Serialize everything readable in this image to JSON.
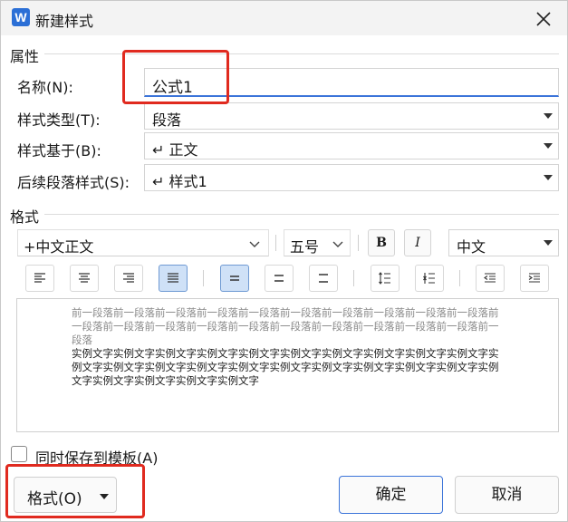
{
  "window": {
    "app_icon": "W",
    "title": "新建样式",
    "close_icon": "close-icon"
  },
  "properties": {
    "group_label": "属性",
    "name_label": "名称(N):",
    "name_value": "公式1",
    "type_label": "样式类型(T):",
    "type_value": "段落",
    "based_label": "样式基于(B):",
    "based_value": "↵ 正文",
    "next_label": "后续段落样式(S):",
    "next_value": "↵ 样式1"
  },
  "format": {
    "group_label": "格式",
    "font": "+中文正文",
    "size": "五号",
    "bold": "B",
    "italic": "I",
    "script": "中文",
    "paragraph_buttons": [
      "align-left-icon",
      "align-center-icon",
      "align-right-icon",
      "align-justify-icon",
      "line-spacing-single-icon",
      "line-spacing-1.5-icon",
      "line-spacing-double-icon",
      "spacing-increase-icon",
      "spacing-decrease-icon",
      "indent-decrease-icon",
      "indent-increase-icon"
    ],
    "active_alignment": "align-justify-icon"
  },
  "preview": {
    "previous_paragraph": "前一段落前一段落前一段落前一段落前一段落前一段落前一段落前一段落前一段落前一段落前一段落前一段落前一段落前一段落前一段落前一段落前一段落前一段落前一段落前一段落前一段落",
    "sample_text": "实例文字实例文字实例文字实例文字实例文字实例文字实例文字实例文字实例文字实例文字实例文字实例文字实例文字实例文字实例文字实例文字实例文字实例文字实例文字实例文字实例文字实例文字实例文字实例文字实例文字"
  },
  "options": {
    "save_to_template": "同时保存到模板(A)",
    "save_to_template_checked": false
  },
  "buttons": {
    "format": "格式(O)",
    "ok": "确定",
    "cancel": "取消"
  },
  "colors": {
    "accent": "#3b74d9",
    "highlight": "#e02a1f",
    "active_button": "#cfe1f7"
  }
}
